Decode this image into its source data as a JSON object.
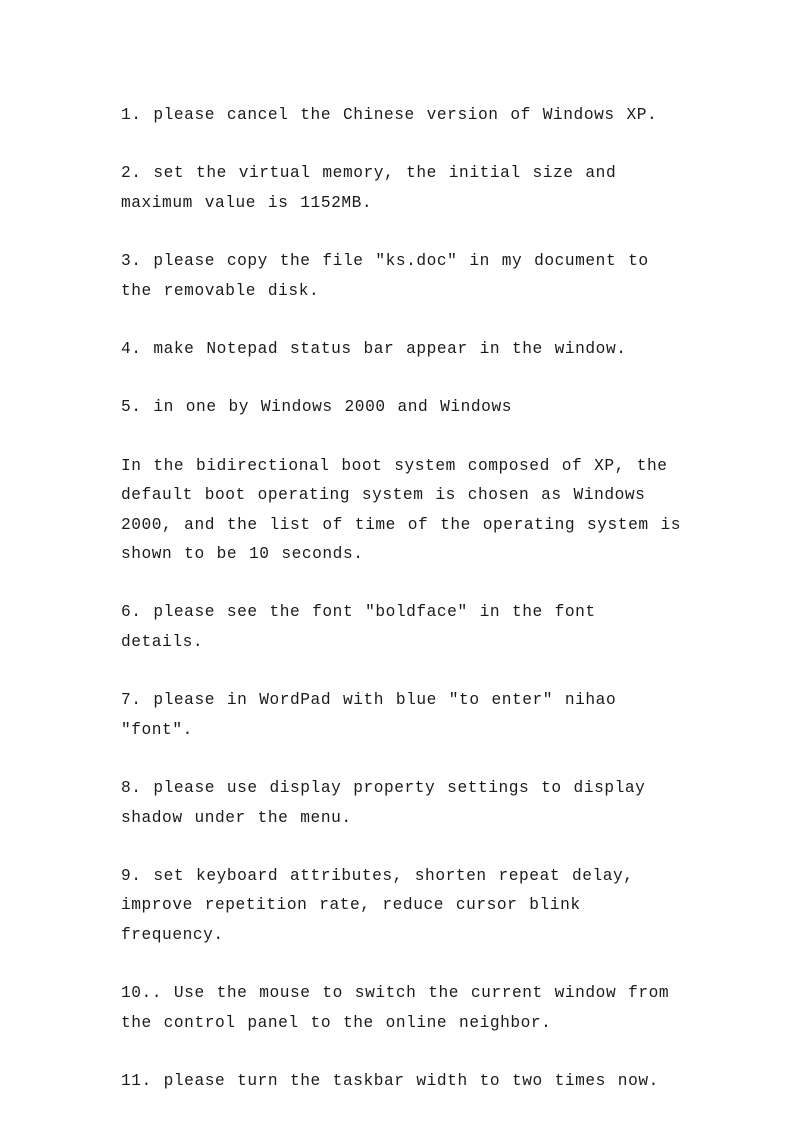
{
  "document": {
    "page_background": "#ffffff",
    "text_color": "#1b1b1b",
    "paragraphs": [
      {
        "id": "item-1",
        "text": "1. please cancel the Chinese version of Windows XP."
      },
      {
        "id": "item-2",
        "text": "2. set the virtual memory, the initial size and maximum value is 1152MB."
      },
      {
        "id": "item-3",
        "text": "3. please copy the file \"ks.doc\" in my document to the removable disk."
      },
      {
        "id": "item-4",
        "text": "4. make Notepad status bar appear in the window."
      },
      {
        "id": "item-5",
        "text": "5. in one by Windows 2000 and Windows"
      },
      {
        "id": "item-5-continuation",
        "text": "In the bidirectional boot system composed of XP, the default boot operating system is chosen as Windows 2000, and the list of time of the operating system is shown to be 10 seconds."
      },
      {
        "id": "item-6",
        "text": "6. please see the font \"boldface\" in the font details."
      },
      {
        "id": "item-7",
        "text": "7. please in WordPad with blue \"to enter\" nihao \"font\"."
      },
      {
        "id": "item-8",
        "text": "8. please use display property settings to display shadow under the menu."
      },
      {
        "id": "item-9",
        "text": "9. set keyboard attributes, shorten repeat delay, improve repetition rate, reduce cursor blink frequency."
      },
      {
        "id": "item-10",
        "text": "10.. Use the mouse to switch the current window from the control panel to the online neighbor."
      },
      {
        "id": "item-11",
        "text": "11. please turn the taskbar width to two times now."
      }
    ]
  }
}
